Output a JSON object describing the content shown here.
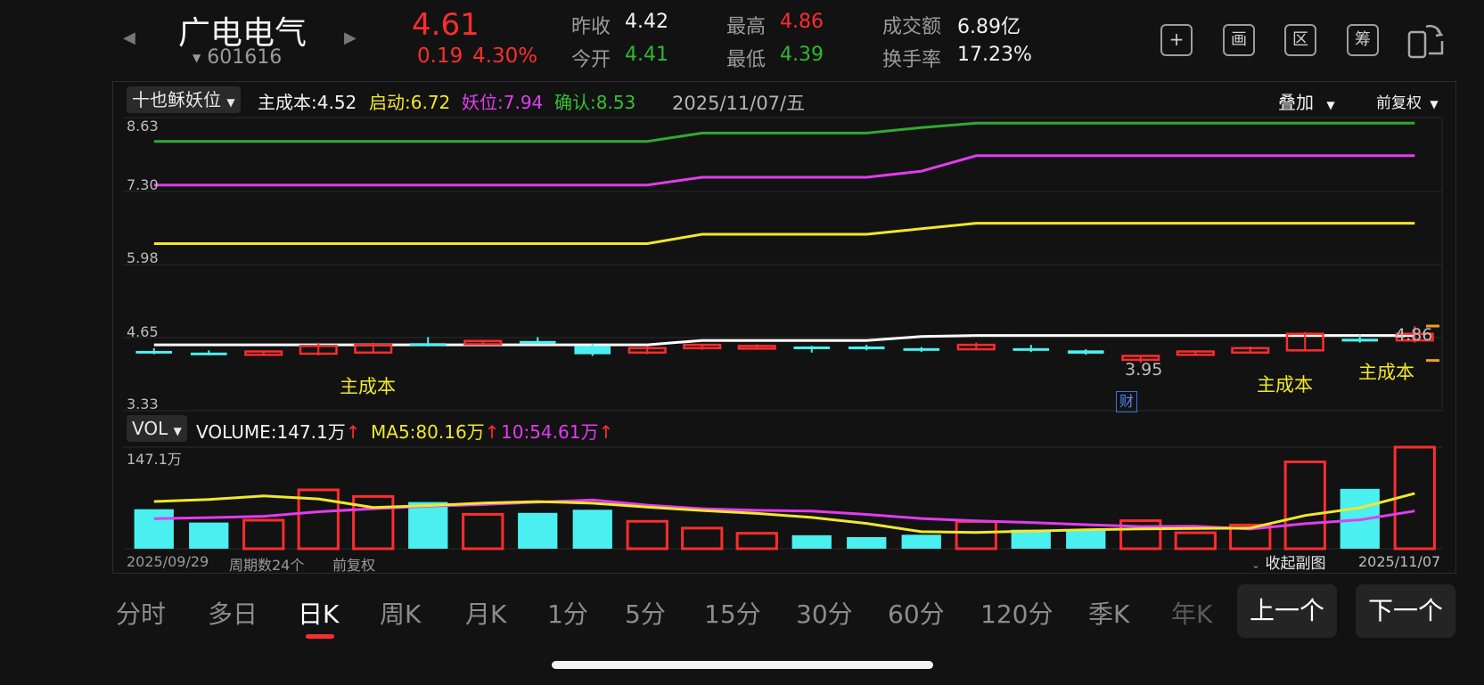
{
  "stock": {
    "name": "广电电气",
    "code": "601616",
    "price": "4.61",
    "change": "0.19",
    "change_pct": "4.30%",
    "prev_close_label": "昨收",
    "prev_close": "4.42",
    "open_label": "今开",
    "open": "4.41",
    "high_label": "最高",
    "high": "4.86",
    "low_label": "最低",
    "low": "4.39",
    "turnover_label": "成交额",
    "turnover": "6.89亿",
    "turnover_rate_label": "换手率",
    "turnover_rate": "17.23%"
  },
  "toolbar": {
    "buttons": [
      {
        "name": "add-button",
        "label": "+"
      },
      {
        "name": "draw-button",
        "label": "画"
      },
      {
        "name": "range-button",
        "label": "区"
      },
      {
        "name": "chips-button",
        "label": "筹"
      },
      {
        "name": "rotate-button",
        "label": ""
      }
    ]
  },
  "indicator": {
    "name": "十也稣妖位",
    "cost_label": "主成本:",
    "cost": "4.52",
    "start_label": "启动:",
    "start": "6.72",
    "demon_label": "妖位:",
    "demon": "7.94",
    "confirm_label": "确认:",
    "confirm": "8.53",
    "date": "2025/11/07/五",
    "overlay_label": "叠加",
    "adjust_label": "前复权"
  },
  "main_chart": {
    "y_ticks": [
      "8.63",
      "7.30",
      "5.98",
      "4.65",
      "3.33"
    ],
    "high_marker": "4.86",
    "low_marker": "3.95",
    "tags": [
      "主成本",
      "主成本",
      "主成本"
    ],
    "finance_badge": "财"
  },
  "volume": {
    "name": "VOL",
    "vol_label": "VOLUME:",
    "vol": "147.1万",
    "ma5_label": "MA5:",
    "ma5": "80.16万",
    "ma10_label": "10:",
    "ma10": "54.61万",
    "arrow": "↑",
    "y_top": "147.1万"
  },
  "footer": {
    "start_date": "2025/09/29",
    "periods": "周期数24个",
    "adjust": "前复权",
    "collapse": "收起副图",
    "end_date": "2025/11/07"
  },
  "tabs": [
    {
      "label": "分时"
    },
    {
      "label": "多日"
    },
    {
      "label": "日K"
    },
    {
      "label": "周K"
    },
    {
      "label": "月K"
    },
    {
      "label": "1分"
    },
    {
      "label": "5分"
    },
    {
      "label": "15分"
    },
    {
      "label": "30分"
    },
    {
      "label": "60分"
    },
    {
      "label": "120分"
    },
    {
      "label": "季K"
    },
    {
      "label": "年K"
    }
  ],
  "nav": {
    "prev": "上一个",
    "next": "下一个"
  },
  "colors": {
    "up": "#ff2d2d",
    "down": "#4af0f0",
    "start_line": "#f0e82a",
    "demon_line": "#e23cf0",
    "confirm_line": "#33a833",
    "cost_line": "#ffffff"
  },
  "chart_data": {
    "type": "candlestick",
    "ylim": [
      3.33,
      8.63
    ],
    "candles": [
      {
        "o": 4.41,
        "h": 4.46,
        "c": 4.38,
        "l": 4.35
      },
      {
        "o": 4.38,
        "h": 4.42,
        "c": 4.35,
        "l": 4.33
      },
      {
        "o": 4.34,
        "h": 4.39,
        "c": 4.4,
        "l": 4.33
      },
      {
        "o": 4.36,
        "h": 4.56,
        "c": 4.5,
        "l": 4.33
      },
      {
        "o": 4.38,
        "h": 4.56,
        "c": 4.52,
        "l": 4.36
      },
      {
        "o": 4.55,
        "h": 4.66,
        "c": 4.53,
        "l": 4.49
      },
      {
        "o": 4.53,
        "h": 4.6,
        "c": 4.59,
        "l": 4.52
      },
      {
        "o": 4.59,
        "h": 4.66,
        "c": 4.57,
        "l": 4.55
      },
      {
        "o": 4.5,
        "h": 4.54,
        "c": 4.35,
        "l": 4.32
      },
      {
        "o": 4.38,
        "h": 4.5,
        "c": 4.46,
        "l": 4.35
      },
      {
        "o": 4.46,
        "h": 4.53,
        "c": 4.52,
        "l": 4.43
      },
      {
        "o": 4.46,
        "h": 4.53,
        "c": 4.5,
        "l": 4.44
      },
      {
        "o": 4.49,
        "h": 4.5,
        "c": 4.47,
        "l": 4.38
      },
      {
        "o": 4.49,
        "h": 4.52,
        "c": 4.44,
        "l": 4.42
      },
      {
        "o": 4.46,
        "h": 4.48,
        "c": 4.45,
        "l": 4.39
      },
      {
        "o": 4.44,
        "h": 4.56,
        "c": 4.52,
        "l": 4.42
      },
      {
        "o": 4.46,
        "h": 4.52,
        "c": 4.45,
        "l": 4.39
      },
      {
        "o": 4.42,
        "h": 4.44,
        "c": 4.36,
        "l": 4.34
      },
      {
        "o": 4.25,
        "h": 4.32,
        "c": 4.32,
        "l": 4.2
      },
      {
        "o": 4.34,
        "h": 4.42,
        "c": 4.4,
        "l": 4.33
      },
      {
        "o": 4.38,
        "h": 4.49,
        "c": 4.46,
        "l": 4.37
      },
      {
        "o": 4.42,
        "h": 4.75,
        "c": 4.72,
        "l": 4.41
      },
      {
        "o": 4.63,
        "h": 4.7,
        "c": 4.58,
        "l": 4.56
      },
      {
        "o": 4.6,
        "h": 4.86,
        "c": 4.72,
        "l": 4.56
      }
    ],
    "lines": {
      "confirm": [
        8.2,
        8.2,
        8.2,
        8.2,
        8.2,
        8.2,
        8.2,
        8.2,
        8.2,
        8.2,
        8.35,
        8.35,
        8.35,
        8.35,
        8.45,
        8.53,
        8.53,
        8.53,
        8.53,
        8.53,
        8.53,
        8.53,
        8.53,
        8.53
      ],
      "demon": [
        7.41,
        7.41,
        7.41,
        7.41,
        7.41,
        7.41,
        7.41,
        7.41,
        7.41,
        7.41,
        7.55,
        7.55,
        7.55,
        7.55,
        7.66,
        7.94,
        7.94,
        7.94,
        7.94,
        7.94,
        7.94,
        7.94,
        7.94,
        7.94
      ],
      "start": [
        6.35,
        6.35,
        6.35,
        6.35,
        6.35,
        6.35,
        6.35,
        6.35,
        6.35,
        6.35,
        6.52,
        6.52,
        6.52,
        6.52,
        6.62,
        6.72,
        6.72,
        6.72,
        6.72,
        6.72,
        6.72,
        6.72,
        6.72,
        6.72
      ],
      "cost": [
        4.52,
        4.52,
        4.52,
        4.52,
        4.52,
        4.52,
        4.52,
        4.52,
        4.52,
        4.52,
        4.6,
        4.6,
        4.6,
        4.6,
        4.67,
        4.69,
        4.69,
        4.69,
        4.69,
        4.69,
        4.69,
        4.69,
        4.69,
        4.69
      ]
    },
    "volume": [
      57.2,
      37.9,
      41.3,
      85.2,
      75.7,
      67.6,
      49.8,
      51.9,
      56.4,
      39.7,
      29.8,
      22.4,
      19.5,
      16.8,
      20.2,
      39.4,
      27.5,
      26.2,
      40.6,
      23.1,
      34.3,
      125.8,
      86.7,
      147.1
    ],
    "volume_up": [
      false,
      false,
      true,
      true,
      true,
      false,
      true,
      false,
      false,
      true,
      true,
      true,
      false,
      false,
      false,
      true,
      false,
      false,
      true,
      true,
      true,
      true,
      false,
      true
    ],
    "ma5": [
      68.4,
      71.2,
      76.5,
      72.1,
      59.8,
      62.5,
      66.1,
      68.3,
      65.9,
      60.2,
      55.4,
      51.1,
      45.3,
      36.7,
      24.7,
      23.5,
      25.6,
      27.4,
      28.8,
      29.4,
      29.9,
      48.1,
      59.2,
      80.16
    ],
    "ma10": [
      43.5,
      45.0,
      47.0,
      53.5,
      58.0,
      61.5,
      64.0,
      67.5,
      70.6,
      63.1,
      58.0,
      55.6,
      54.4,
      49.7,
      43.7,
      40.4,
      38.0,
      34.8,
      32.1,
      32.6,
      28.5,
      36.2,
      41.8,
      54.61
    ]
  }
}
